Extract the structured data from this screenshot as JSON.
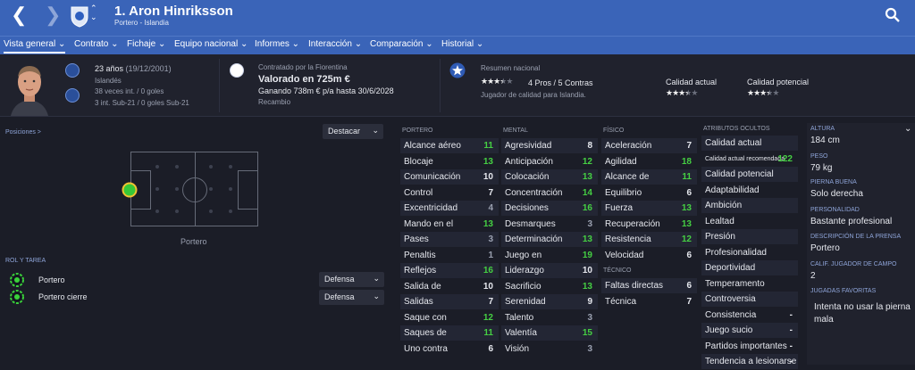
{
  "header": {
    "player_name": "1. Aron Hinriksson",
    "player_sub": "Portero - Islandia",
    "back_icon": "chevron-left-icon",
    "forward_icon": "chevron-right-icon",
    "search_icon": "search-icon",
    "accent": "#3a64b8"
  },
  "tabs": [
    {
      "label": "Vista general"
    },
    {
      "label": "Contrato"
    },
    {
      "label": "Fichaje"
    },
    {
      "label": "Equipo nacional"
    },
    {
      "label": "Informes"
    },
    {
      "label": "Interacción"
    },
    {
      "label": "Comparación"
    },
    {
      "label": "Historial"
    }
  ],
  "info": {
    "age": "23 años",
    "dob": "(19/12/2001)",
    "nationality": "Islandés",
    "caps": "38 veces int. / 0 goles",
    "u21": "3 int. Sub-21 / 0 goles Sub-21",
    "contract_by": "Contratado por la Fiorentina",
    "value": "Valorado en 725m €",
    "wage": "Ganando 738m € p/a hasta 30/6/2028",
    "role": "Recambio",
    "nat_summary": "Resumen nacional",
    "pros_cons": "4 Pros / 5 Contras",
    "nat_desc": "Jugador de calidad para Islandia.",
    "nat_stars": 3.5,
    "current_label": "Calidad actual",
    "current_stars": 3.5,
    "potential_label": "Calidad potencial",
    "potential_stars": 3.5
  },
  "positions": {
    "title": "Posiciones >",
    "highlight": "Destacar",
    "position_label": "Portero"
  },
  "roles": {
    "title": "ROL Y TAREA",
    "items": [
      {
        "name": "Portero",
        "duty": "Defensa"
      },
      {
        "name": "Portero cierre",
        "duty": "Defensa"
      }
    ]
  },
  "attributes": {
    "portero": {
      "title": "PORTERO",
      "rows": [
        {
          "name": "Alcance aéreo",
          "value": "11"
        },
        {
          "name": "Blocaje",
          "value": "13"
        },
        {
          "name": "Comunicación",
          "value": "10"
        },
        {
          "name": "Control",
          "value": "7"
        },
        {
          "name": "Excentricidad",
          "value": "4"
        },
        {
          "name": "Mando en el",
          "value": "13"
        },
        {
          "name": "Pases",
          "value": "3"
        },
        {
          "name": "Penaltis",
          "value": "1"
        },
        {
          "name": "Reflejos",
          "value": "16"
        },
        {
          "name": "Salida de",
          "value": "10"
        },
        {
          "name": "Salidas",
          "value": "7"
        },
        {
          "name": "Saque con",
          "value": "12"
        },
        {
          "name": "Saques de",
          "value": "11"
        },
        {
          "name": "Uno contra",
          "value": "6"
        }
      ]
    },
    "mental": {
      "title": "MENTAL",
      "rows": [
        {
          "name": "Agresividad",
          "value": "8"
        },
        {
          "name": "Anticipación",
          "value": "12"
        },
        {
          "name": "Colocación",
          "value": "13"
        },
        {
          "name": "Concentración",
          "value": "14"
        },
        {
          "name": "Decisiones",
          "value": "16"
        },
        {
          "name": "Desmarques",
          "value": "3"
        },
        {
          "name": "Determinación",
          "value": "13"
        },
        {
          "name": "Juego en",
          "value": "19"
        },
        {
          "name": "Liderazgo",
          "value": "10"
        },
        {
          "name": "Sacrificio",
          "value": "13"
        },
        {
          "name": "Serenidad",
          "value": "9"
        },
        {
          "name": "Talento",
          "value": "3"
        },
        {
          "name": "Valentía",
          "value": "15"
        },
        {
          "name": "Visión",
          "value": "3"
        }
      ]
    },
    "fisico": {
      "title": "FÍSICO",
      "rows": [
        {
          "name": "Aceleración",
          "value": "7"
        },
        {
          "name": "Agilidad",
          "value": "18"
        },
        {
          "name": "Alcance de",
          "value": "11"
        },
        {
          "name": "Equilibrio",
          "value": "6"
        },
        {
          "name": "Fuerza",
          "value": "13"
        },
        {
          "name": "Recuperación",
          "value": "13"
        },
        {
          "name": "Resistencia",
          "value": "12"
        },
        {
          "name": "Velocidad",
          "value": "6"
        }
      ]
    },
    "tecnico": {
      "title": "TÉCNICO",
      "rows": [
        {
          "name": "Faltas directas",
          "value": "6"
        },
        {
          "name": "Técnica",
          "value": "7"
        }
      ]
    },
    "ocultos": {
      "title": "ATRIBUTOS OCULTOS",
      "rows": [
        {
          "name": "Calidad actual",
          "value": ""
        },
        {
          "name": "Calidad actual recomendada",
          "value": "122"
        },
        {
          "name": "Calidad potencial",
          "value": ""
        },
        {
          "name": "Adaptabilidad",
          "value": ""
        },
        {
          "name": "Ambición",
          "value": ""
        },
        {
          "name": "Lealtad",
          "value": ""
        },
        {
          "name": "Presión",
          "value": ""
        },
        {
          "name": "Profesionalidad",
          "value": ""
        },
        {
          "name": "Deportividad",
          "value": ""
        },
        {
          "name": "Temperamento",
          "value": ""
        },
        {
          "name": "Controversia",
          "value": ""
        },
        {
          "name": "Consistencia",
          "value": "-"
        },
        {
          "name": "Juego sucio",
          "value": "-"
        },
        {
          "name": "Partidos importantes",
          "value": "-"
        },
        {
          "name": "Tendencia a lesionarse",
          "value": "-"
        }
      ]
    }
  },
  "details": [
    {
      "key": "ALTURA",
      "value": "184 cm"
    },
    {
      "key": "PESO",
      "value": "79 kg"
    },
    {
      "key": "PIERNA BUENA",
      "value": "Solo derecha"
    },
    {
      "key": "PERSONALIDAD",
      "value": "Bastante profesional"
    },
    {
      "key": "DESCRIPCIÓN DE LA PRENSA",
      "value": "Portero"
    },
    {
      "key": "CALIF. JUGADOR DE CAMPO",
      "value": "2"
    },
    {
      "key": "JUGADAS FAVORITAS",
      "value": "Intenta no usar la pierna mala"
    }
  ]
}
